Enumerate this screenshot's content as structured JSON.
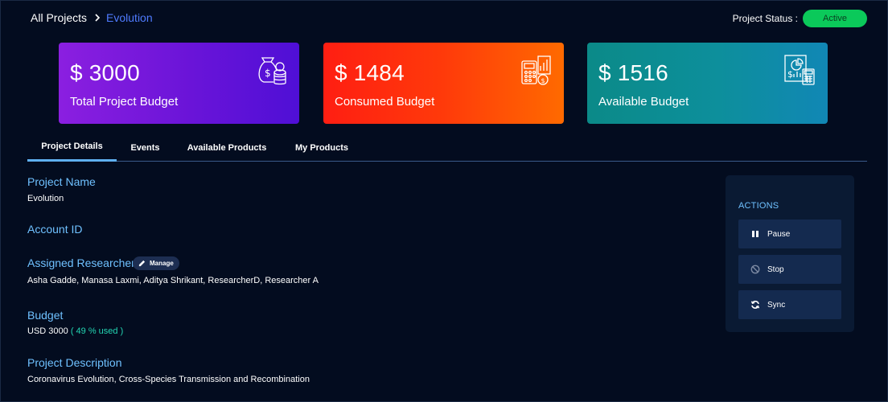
{
  "breadcrumb": {
    "root": "All Projects",
    "separator_icon": "chevron-right-icon",
    "current": "Evolution"
  },
  "status": {
    "label": "Project Status :",
    "value": "Active",
    "color": "#0bc95a"
  },
  "cards": [
    {
      "amount": "$ 3000",
      "label": "Total Project Budget",
      "icon": "money-bag-coins-icon",
      "gradient": [
        "#8b1fe0",
        "#4f0fd6"
      ]
    },
    {
      "amount": "$ 1484",
      "label": "Consumed Budget",
      "icon": "calculator-chart-icon",
      "gradient": [
        "#ff1e12",
        "#ff6a00"
      ]
    },
    {
      "amount": "$ 1516",
      "label": "Available Budget",
      "icon": "budget-report-icon",
      "gradient": [
        "#0b8a88",
        "#1187b5"
      ]
    }
  ],
  "tabs": [
    {
      "label": "Project Details",
      "active": true
    },
    {
      "label": "Events",
      "active": false
    },
    {
      "label": "Available Products",
      "active": false
    },
    {
      "label": "My Products",
      "active": false
    }
  ],
  "details": {
    "project_name": {
      "title": "Project Name",
      "value": "Evolution"
    },
    "account_id": {
      "title": "Account ID",
      "value": ""
    },
    "researchers": {
      "title": "Assigned Researchers",
      "manage_label": "Manage",
      "value": "Asha Gadde, Manasa Laxmi, Aditya Shrikant, ResearcherD, Researcher A"
    },
    "budget": {
      "title": "Budget",
      "value": "USD 3000",
      "used": "( 49 % used )"
    },
    "description": {
      "title": "Project Description",
      "value": "Coronavirus Evolution, Cross-Species Transmission and Recombination"
    }
  },
  "actions": {
    "title": "ACTIONS",
    "buttons": [
      {
        "label": "Pause",
        "icon": "pause-icon"
      },
      {
        "label": "Stop",
        "icon": "stop-icon"
      },
      {
        "label": "Sync",
        "icon": "sync-icon"
      }
    ]
  },
  "colors": {
    "background": "#030c1f",
    "accent": "#6fc1ff",
    "link": "#4f7bff",
    "used": "#23d6b3"
  }
}
